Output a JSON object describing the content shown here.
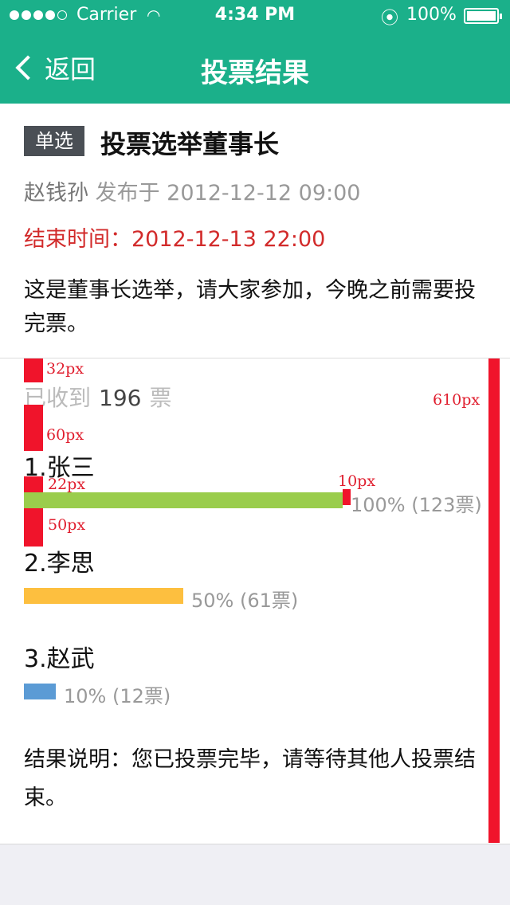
{
  "status_bar": {
    "carrier": "Carrier",
    "time": "4:34 PM",
    "battery": "100%"
  },
  "nav": {
    "back_label": "返回",
    "title": "投票结果"
  },
  "poll": {
    "type_tag": "单选",
    "title": "投票选举董事长",
    "author": "赵钱孙",
    "published": "发布于 2012-12-12  09:00",
    "end_time": "结束时间：2012-12-13 22:00",
    "description": "这是董事长选举，请大家参加，今晚之前需要投完票。"
  },
  "received": {
    "prefix": "已收到",
    "count": "196",
    "suffix": "票"
  },
  "options": [
    {
      "label": "1.张三",
      "percent": 100,
      "stats": "100% (123票)",
      "color": "#9acd4c"
    },
    {
      "label": "2.李思",
      "percent": 50,
      "stats": "50% (61票)",
      "color": "#fdbf3f"
    },
    {
      "label": "3.赵武",
      "percent": 10,
      "stats": "10% (12票)",
      "color": "#5b9bd5"
    }
  ],
  "result_note": "结果说明：您已投票完毕，请等待其他人投票结束。",
  "annotations": {
    "a1": "32px",
    "a2": "60px",
    "a3": "22px",
    "a4": "10px",
    "a5": "50px",
    "a6": "610px",
    "color": "#f0142b"
  }
}
